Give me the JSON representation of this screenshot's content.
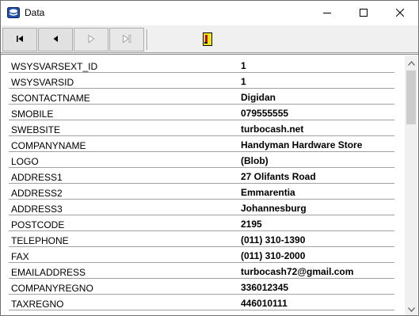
{
  "window": {
    "title": "Data",
    "app_icon": "database-icon",
    "controls": {
      "minimize": "minimize-icon",
      "maximize": "maximize-icon",
      "close": "close-icon"
    }
  },
  "toolbar": {
    "buttons": [
      {
        "icon": "first-record-icon",
        "enabled": true
      },
      {
        "icon": "prior-record-icon",
        "enabled": true
      },
      {
        "icon": "next-record-icon",
        "enabled": false
      },
      {
        "icon": "last-record-icon",
        "enabled": false
      }
    ],
    "indicator": "edit-state-icon",
    "colors": {
      "indicator_fill": "#f2e900",
      "indicator_mark": "#c00000"
    }
  },
  "records": [
    {
      "field": "WSYSVARSEXT_ID",
      "value": "1"
    },
    {
      "field": "WSYSVARSID",
      "value": "1"
    },
    {
      "field": "SCONTACTNAME",
      "value": "Digidan"
    },
    {
      "field": "SMOBILE",
      "value": "079555555"
    },
    {
      "field": "SWEBSITE",
      "value": "turbocash.net"
    },
    {
      "field": "COMPANYNAME",
      "value": "Handyman Hardware Store"
    },
    {
      "field": "LOGO",
      "value": "(Blob)"
    },
    {
      "field": "ADDRESS1",
      "value": "27 Olifants Road"
    },
    {
      "field": "ADDRESS2",
      "value": "Emmarentia"
    },
    {
      "field": "ADDRESS3",
      "value": "Johannesburg"
    },
    {
      "field": "POSTCODE",
      "value": "2195"
    },
    {
      "field": "TELEPHONE",
      "value": "(011) 310-1390"
    },
    {
      "field": "FAX",
      "value": "(011) 310-2000"
    },
    {
      "field": "EMAILADDRESS",
      "value": "turbocash72@gmail.com"
    },
    {
      "field": "COMPANYREGNO",
      "value": "336012345"
    },
    {
      "field": "TAXREGNO",
      "value": "446010111"
    }
  ]
}
